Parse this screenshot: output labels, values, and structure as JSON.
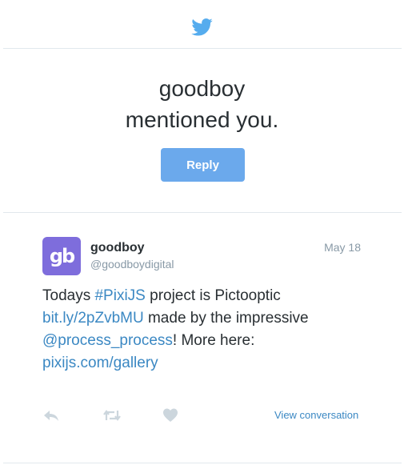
{
  "header": {
    "icon": "twitter-bird-icon",
    "accent": "#55acee"
  },
  "notification": {
    "line1": "goodboy",
    "line2": "mentioned you.",
    "reply_label": "Reply",
    "button_color": "#6ba9ec"
  },
  "tweet": {
    "avatar_text": "gb",
    "avatar_color": "#7e6ddc",
    "name": "goodboy",
    "handle": "@goodboydigital",
    "date": "May 18",
    "text": {
      "part1": "Todays ",
      "hashtag": "#PixiJS",
      "part2": " project is Pictooptic",
      "link1": "bit.ly/2pZvbMU",
      "part3": " made by the impressive",
      "mention": "@process_process",
      "part4": "! More here:",
      "link2": "pixijs.com/gallery"
    },
    "link_color": "#3b88c3"
  },
  "actions": {
    "reply_icon": "reply-icon",
    "retweet_icon": "retweet-icon",
    "like_icon": "heart-icon",
    "view_conversation_label": "View conversation"
  }
}
